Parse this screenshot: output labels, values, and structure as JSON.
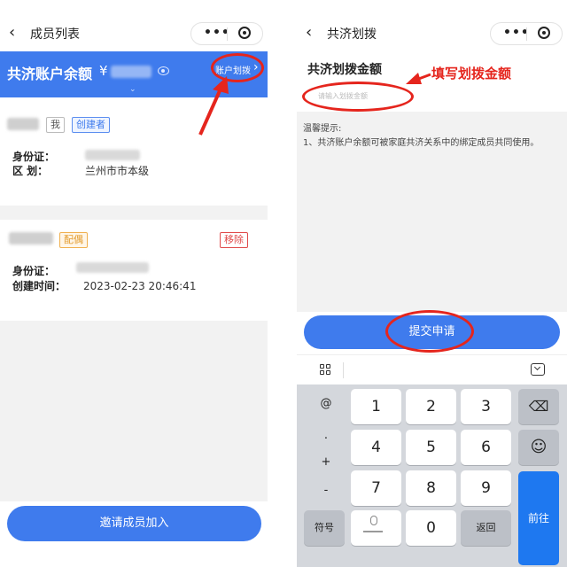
{
  "left_screen": {
    "nav": {
      "back_icon": "‹",
      "title": "成员列表"
    },
    "banner": {
      "title": "共济账户余额",
      "currency": "¥",
      "transfer_label": "账户划拨",
      "transfer_chevron": "›",
      "expand_chevron": "⌄"
    },
    "member1": {
      "tag_self": "我",
      "tag_role": "创建者",
      "id_label": "身份证：",
      "district_label": "区 划：",
      "district_value": "兰州市市本级"
    },
    "member2": {
      "tag_relation": "配偶",
      "remove_label": "移除",
      "id_label": "身份证：",
      "created_label": "创建时间：",
      "created_value": "2023-02-23 20:46:41"
    },
    "invite_button": "邀请成员加入"
  },
  "right_screen": {
    "nav": {
      "back_icon": "‹",
      "title": "共济划拨"
    },
    "heading": "共济划拨金额",
    "amount_placeholder": "请输入划拨金额",
    "annotation": "填写划拨金额",
    "tips": {
      "title": "温馨提示:",
      "item1": "1、共济账户余额可被家庭共济关系中的绑定成员共同使用。"
    },
    "submit_button": "提交申请",
    "keyboard": {
      "symbols": [
        "@",
        ".",
        "+",
        "-"
      ],
      "numbers": [
        "1",
        "2",
        "3",
        "4",
        "5",
        "6",
        "7",
        "8",
        "9",
        "0"
      ],
      "symbol_key": "符号",
      "return_key": "返回",
      "enter_key": "前往",
      "backspace_icon": "⌫",
      "emoji_icon": "☺"
    }
  },
  "colors": {
    "primary": "#3f7bed",
    "annotation_red": "#e5251d",
    "keyboard_bg": "#d4d7dc"
  }
}
